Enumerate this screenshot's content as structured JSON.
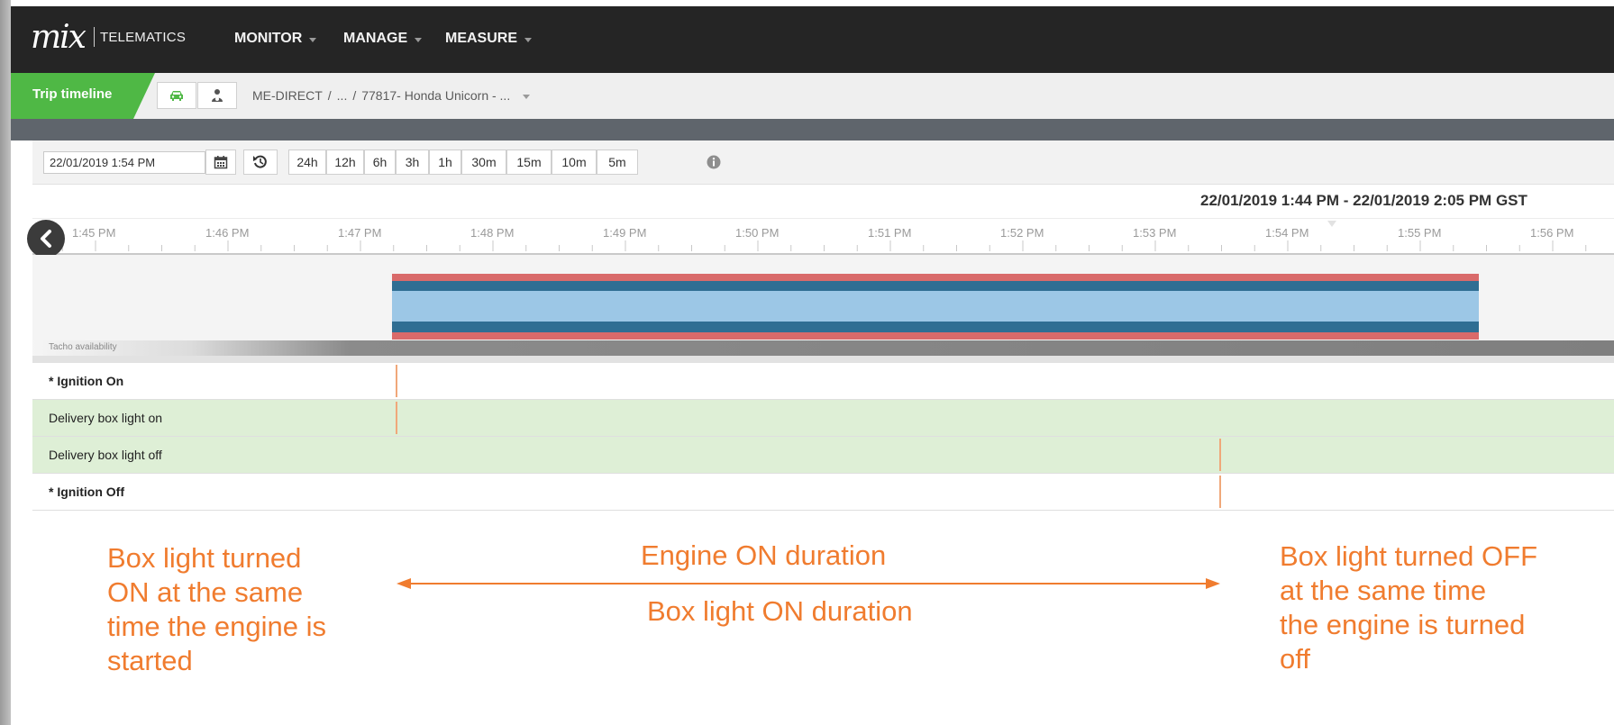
{
  "nav": {
    "logo": "mix",
    "logo_text": "TELEMATICS",
    "menu": [
      "MONITOR",
      "MANAGE",
      "MEASURE"
    ]
  },
  "crumbs": {
    "tab": "Trip timeline",
    "org": "ME-DIRECT",
    "ellipsis": "...",
    "vehicle": "77817- Honda Unicorn - ..."
  },
  "toolbar": {
    "date_value": "22/01/2019 1:54 PM",
    "ranges": [
      "24h",
      "12h",
      "6h",
      "3h",
      "1h",
      "30m",
      "15m",
      "10m",
      "5m"
    ]
  },
  "timeline": {
    "range_label": "22/01/2019 1:44 PM  -  22/01/2019 2:05 PM GST",
    "ticks": [
      "1:45 PM",
      "1:46 PM",
      "1:47 PM",
      "1:48 PM",
      "1:49 PM",
      "1:50 PM",
      "1:51 PM",
      "1:52 PM",
      "1:53 PM",
      "1:54 PM",
      "1:55 PM",
      "1:56 PM"
    ],
    "tacho_label": "Tacho availability"
  },
  "events": [
    {
      "label": "* Ignition On"
    },
    {
      "label": "Delivery box light on"
    },
    {
      "label": "Delivery box light off"
    },
    {
      "label": "* Ignition Off"
    }
  ],
  "annotations": {
    "left": [
      "Box light turned",
      "ON at the same",
      "time the engine is",
      "started"
    ],
    "center_top": "Engine ON duration",
    "center_bottom": "Box light ON duration",
    "right": [
      "Box light turned OFF",
      "at the same time",
      "the engine is turned",
      "off"
    ]
  },
  "colors": {
    "accent_green": "#4fb845",
    "nav_bg": "#252525",
    "trip_red": "#d96a6a",
    "trip_dark_blue": "#2f6e93",
    "trip_light_blue": "#9cc7e6",
    "row_green": "#deefd6",
    "annotation_orange": "#f07c2f"
  },
  "icons": [
    "car-icon",
    "driver-icon",
    "calendar-icon",
    "refresh-icon",
    "info-icon",
    "chevron-left-icon",
    "caret-down-icon"
  ]
}
